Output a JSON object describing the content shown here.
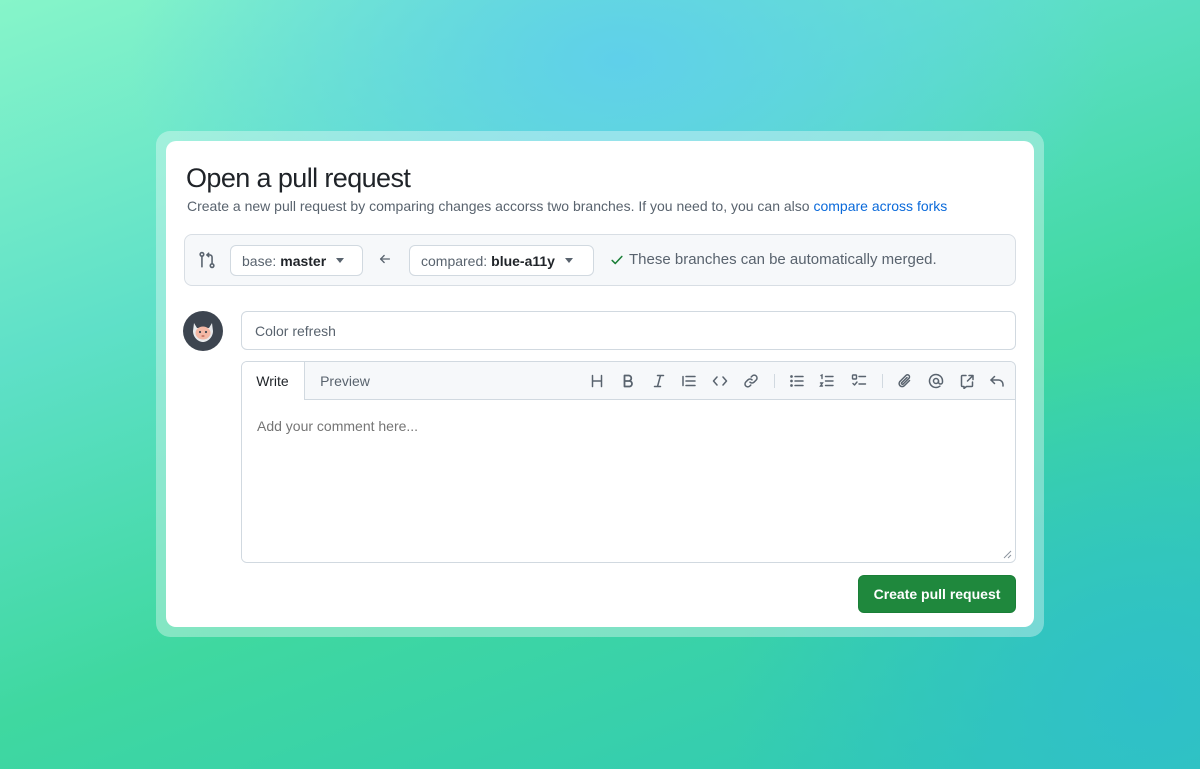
{
  "header": {
    "title": "Open a pull request",
    "subtitle": "Create a new pull request by comparing changes accorss two branches. If you need to, you can also ",
    "subtitle_link": "compare across forks"
  },
  "compare": {
    "base_prefix": "base:",
    "base_branch": "master",
    "compare_prefix": "compared:",
    "compare_branch": "blue-a11y",
    "merge_status": "These branches can be automatically merged."
  },
  "form": {
    "title_value": "Color refresh",
    "tabs": [
      {
        "label": "Write",
        "active": true
      },
      {
        "label": "Preview",
        "active": false
      }
    ],
    "toolbar_icons": [
      "heading-icon",
      "bold-icon",
      "italic-icon",
      "quote-icon",
      "code-icon",
      "link-icon",
      "bulleted-list-icon",
      "numbered-list-icon",
      "task-list-icon",
      "attach-icon",
      "mention-icon",
      "reference-icon",
      "undo-icon"
    ],
    "comment_placeholder": "Add your comment here...",
    "submit_label": "Create pull request"
  },
  "colors": {
    "accent_link": "#0969da",
    "primary_button": "#1f883d",
    "success_check": "#1a7f37"
  }
}
